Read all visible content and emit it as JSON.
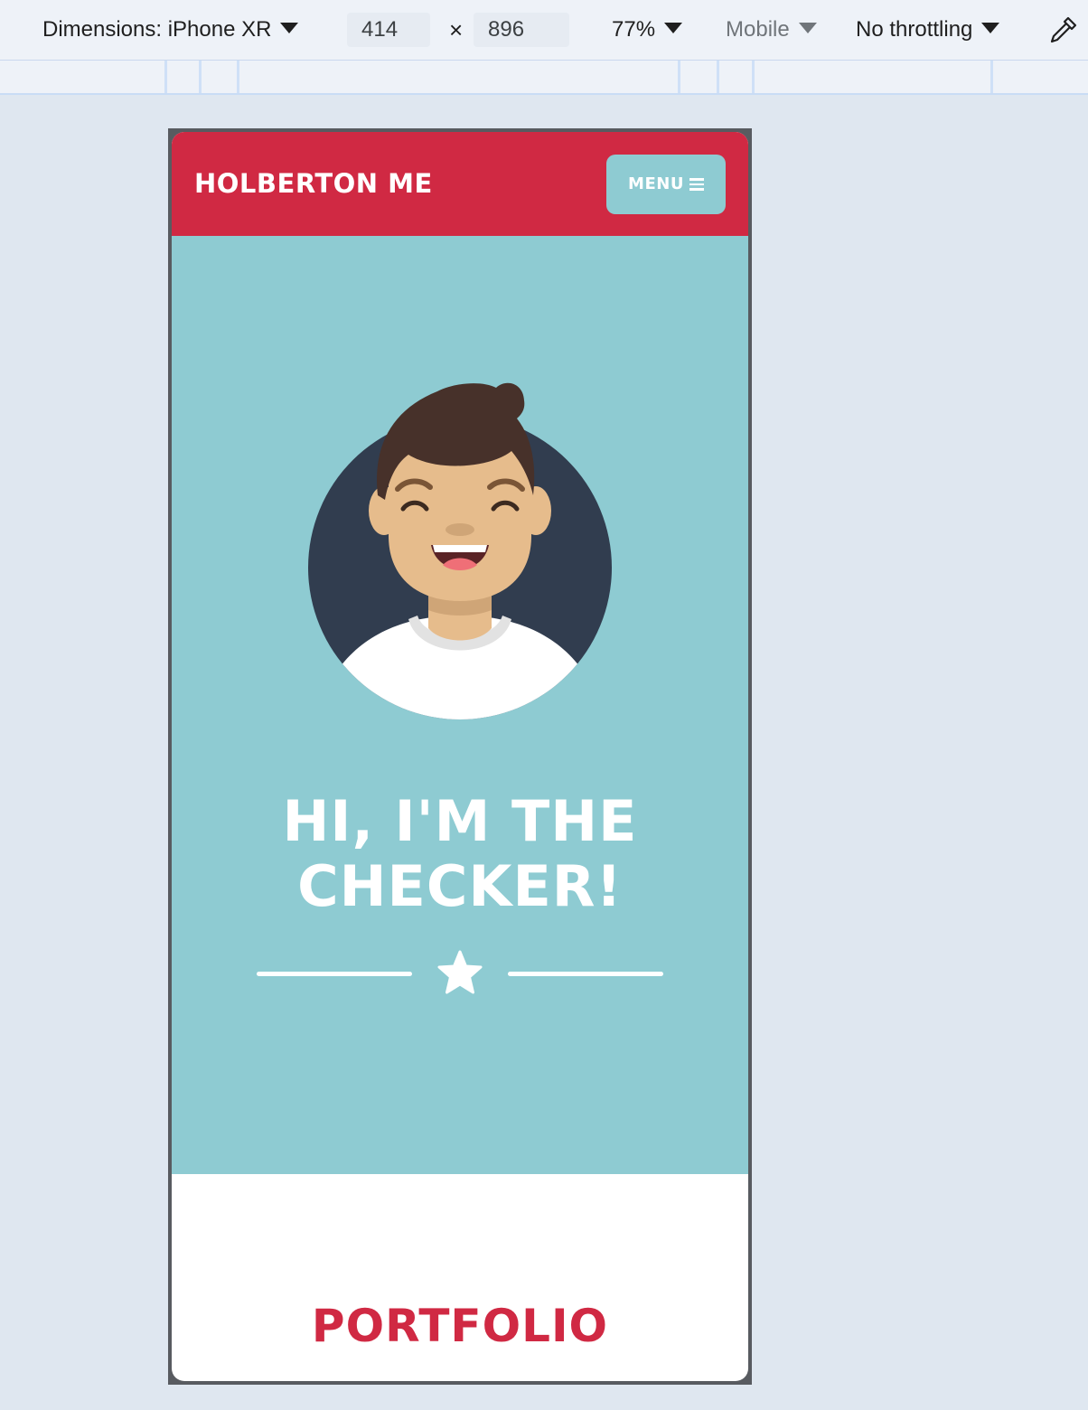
{
  "devtools": {
    "dimensions_label": "Dimensions: iPhone XR",
    "width": "414",
    "times": "×",
    "height": "896",
    "zoom": "77%",
    "device_type": "Mobile",
    "throttling": "No throttling"
  },
  "site": {
    "brand": "HOLBERTON ME",
    "menu_label": "MENU",
    "hero_title_line1": "HI, I'M THE",
    "hero_title_line2": "CHECKER!",
    "portfolio_heading": "PORTFOLIO"
  },
  "colors": {
    "header": "#d02943",
    "hero": "#8ecbd2",
    "avatar_bg": "#313d4f"
  },
  "icons": [
    "chevron-down-icon",
    "eyedropper-icon",
    "hamburger-icon",
    "star-icon",
    "avatar-illustration"
  ]
}
